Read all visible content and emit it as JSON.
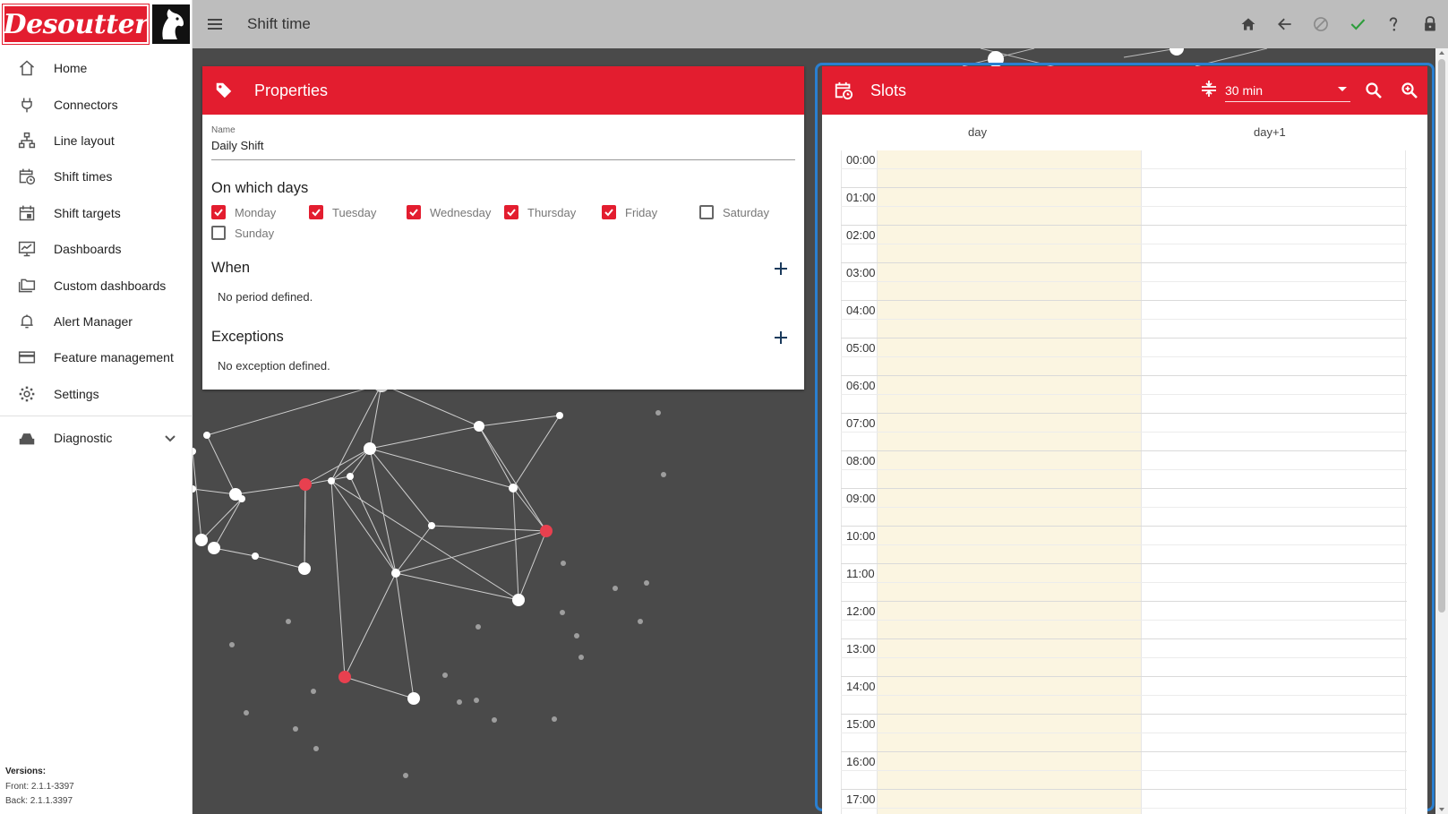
{
  "app": {
    "brand": "Desoutter",
    "page_title": "Shift time"
  },
  "sidebar": {
    "items": [
      {
        "label": "Home",
        "icon": "home-icon"
      },
      {
        "label": "Connectors",
        "icon": "plug-icon"
      },
      {
        "label": "Line layout",
        "icon": "network-icon"
      },
      {
        "label": "Shift times",
        "icon": "calendar-clock-icon"
      },
      {
        "label": "Shift targets",
        "icon": "calendar-icon"
      },
      {
        "label": "Dashboards",
        "icon": "monitor-icon"
      },
      {
        "label": "Custom dashboards",
        "icon": "folders-icon"
      },
      {
        "label": "Alert Manager",
        "icon": "bell-icon"
      },
      {
        "label": "Feature management",
        "icon": "card-icon"
      },
      {
        "label": "Settings",
        "icon": "gear-icon"
      }
    ],
    "diagnostic": {
      "label": "Diagnostic",
      "icon": "diagnostic-icon"
    },
    "versions": {
      "title": "Versions:",
      "front": "Front: 2.1.1-3397",
      "back": "Back: 2.1.1.3397"
    }
  },
  "topbar": {
    "actions": [
      "home-icon",
      "back-arrow-icon",
      "cancel-icon",
      "check-icon",
      "help-icon",
      "lock-icon"
    ]
  },
  "properties": {
    "title": "Properties",
    "name_label": "Name",
    "name_value": "Daily Shift",
    "days_title": "On which days",
    "days": [
      {
        "label": "Monday",
        "checked": true
      },
      {
        "label": "Tuesday",
        "checked": true
      },
      {
        "label": "Wednesday",
        "checked": true
      },
      {
        "label": "Thursday",
        "checked": true
      },
      {
        "label": "Friday",
        "checked": true
      },
      {
        "label": "Saturday",
        "checked": false
      },
      {
        "label": "Sunday",
        "checked": false
      }
    ],
    "when_title": "When",
    "when_empty": "No period defined.",
    "exceptions_title": "Exceptions",
    "exceptions_empty": "No exception defined."
  },
  "slots": {
    "title": "Slots",
    "slot_size": "30 min",
    "columns": [
      "day",
      "day+1"
    ],
    "hours": [
      "00:00",
      "01:00",
      "02:00",
      "03:00",
      "04:00",
      "05:00",
      "06:00",
      "07:00",
      "08:00",
      "09:00",
      "10:00",
      "11:00",
      "12:00",
      "13:00",
      "14:00",
      "15:00",
      "16:00",
      "17:00"
    ]
  },
  "colors": {
    "brand_red": "#e31d2f",
    "topbar_gray": "#bdbdbd",
    "main_bg": "#4a4a4a",
    "day_column": "#fbf5e1",
    "highlight_outline": "#2a7fd0",
    "check_green": "#2e9d3c"
  }
}
